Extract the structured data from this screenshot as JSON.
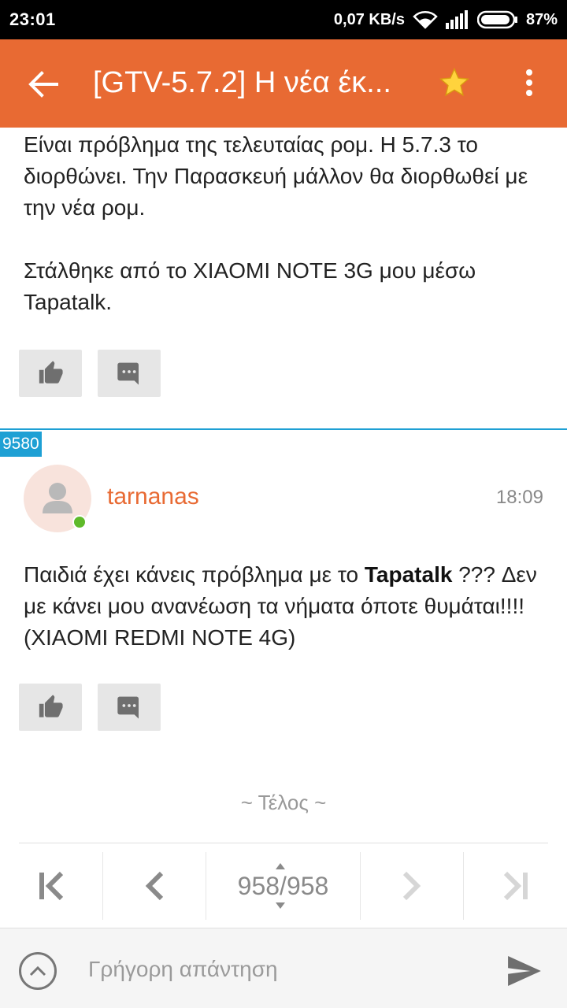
{
  "status_bar": {
    "time": "23:01",
    "network_speed": "0,07 KB/s",
    "battery": "87%"
  },
  "app_bar": {
    "title": "[GTV-5.7.2] Η νέα έκ...",
    "back_icon": "arrow-left",
    "star_icon": "star",
    "more_icon": "more-vert",
    "star_color": "#ffd33d"
  },
  "posts": [
    {
      "lines_1": "Είναι πρόβλημα της τελευταίας ρομ. Η 5.7.3 το διορθώνει. Την Παρασκευή μάλλον θα διορθωθεί με την νέα ρομ.",
      "signature": "Στάλθηκε από το XIAOMI NOTE 3G μου μέσω Tapatalk."
    },
    {
      "number": "9580",
      "username": "tarnanas",
      "time": "18:09",
      "text_before": "Παιδιά έχει κάνεις πρόβλημα με το ",
      "text_bold": "Tapatalk",
      "text_after": " ??? Δεν με κάνει μου ανανέωση τα νήματα όποτε θυμάται!!!! (XIAOMI REDMI NOTE 4G)"
    }
  ],
  "end_label": "~ Τέλος ~",
  "pagination": {
    "page": "958/958"
  },
  "reply": {
    "placeholder": "Γρήγορη απάντηση"
  },
  "colors": {
    "accent": "#e86a33",
    "divider": "#1ea0d4",
    "online": "#5fba2a"
  }
}
